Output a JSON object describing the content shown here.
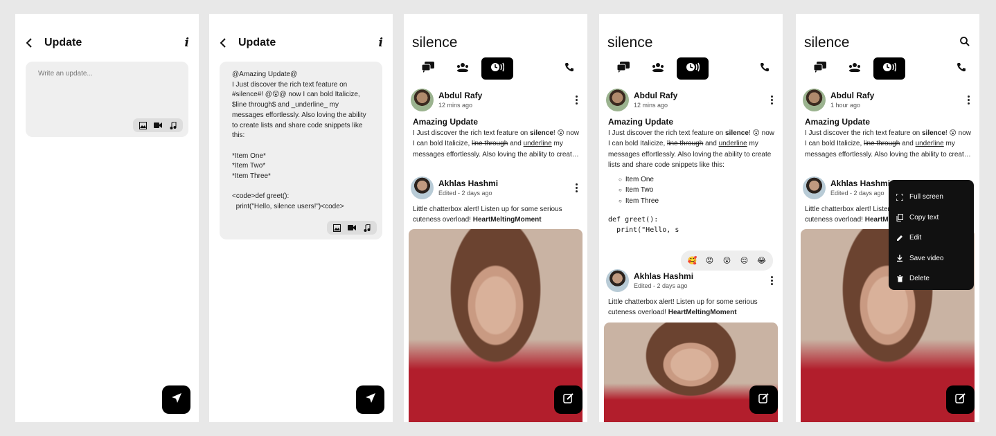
{
  "compose": {
    "title": "Update",
    "info_glyph": "i",
    "placeholder": "Write an update...",
    "draft_text": "@Amazing Update@\nI Just discover the rich text feature on #silence#! @😲@ now I can bold Italicize, $line through$ and _underline_ my messages effortlessly. Also loving the ability to create lists and share code snippets like this:\n\n*Item One*\n*Item Two*\n*Item Three*\n\n<code>def greet():\n  print(\"Hello, silence users!\")<code>",
    "attach_icons": [
      "image-icon",
      "video-icon",
      "music-icon"
    ],
    "send_icon": "send-icon"
  },
  "feed": {
    "app_title": "silence",
    "tabs": [
      "chats-icon",
      "groups-icon",
      "updates-icon",
      "call-icon"
    ],
    "active_tab": "updates-icon"
  },
  "posts": {
    "p1": {
      "author": "Abdul Rafy",
      "time_a": "12 mins ago",
      "time_b": "1 hour ago",
      "title": "Amazing Update",
      "text_1": "I Just discover the rich text feature on ",
      "bold": "silence",
      "text_2": "! 😲 now I can bold Italicize, ",
      "strike": "line through",
      "text_3": " and ",
      "underline": "underline",
      "text_4": " my messages effortlessly. Also loving the ability to create lists and share code snippets like this:",
      "items": [
        "Item One",
        "Item Two",
        "Item Three"
      ],
      "code": "def greet():\n  print(\"Hello, s"
    },
    "p2": {
      "author": "Akhlas Hashmi",
      "time": "Edited - 2 days ago",
      "text": "Little chatterbox alert! Listen up for some serious cuteness overload! ",
      "tag": "HeartMeltingMoment"
    }
  },
  "reactions": [
    "🥰",
    "😡",
    "😲",
    "😔",
    "😂"
  ],
  "context_menu": [
    "Full screen",
    "Copy text",
    "Edit",
    "Save video",
    "Delete"
  ]
}
